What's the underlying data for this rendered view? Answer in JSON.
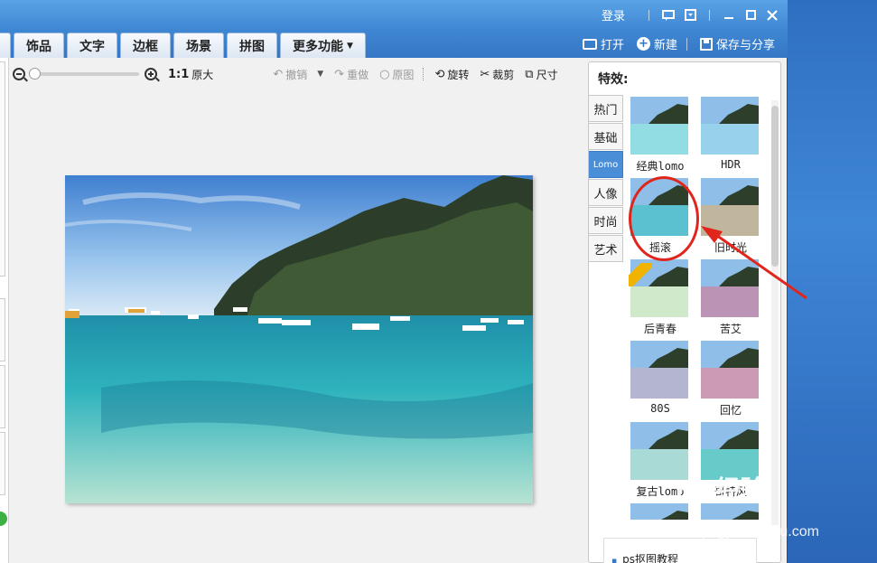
{
  "titlebar": {
    "login": "登录"
  },
  "tabs": [
    {
      "label": "容"
    },
    {
      "label": "饰品"
    },
    {
      "label": "文字"
    },
    {
      "label": "边框"
    },
    {
      "label": "场景"
    },
    {
      "label": "拼图"
    },
    {
      "label": "更多功能"
    }
  ],
  "actions": {
    "open": "打开",
    "new": "新建",
    "save_share": "保存与分享"
  },
  "toolbar": {
    "ratio": "1:1",
    "original_size": "原大",
    "undo": "撤销",
    "redo": "重做",
    "original_image": "原图",
    "rotate": "旋转",
    "crop": "裁剪",
    "size": "尺寸"
  },
  "panel": {
    "title": "特效:",
    "categories": [
      "热门",
      "基础",
      "Lomo",
      "人像",
      "时尚",
      "艺术"
    ],
    "active_category": "Lomo",
    "effects": [
      {
        "label": "经典lomo",
        "tint": "#7fd6e0"
      },
      {
        "label": "HDR",
        "tint": "#86c9e8"
      },
      {
        "label": "摇滚",
        "tint": "#3fb7c9"
      },
      {
        "label": "旧时光",
        "tint": "#b5a98c"
      },
      {
        "label": "后青春",
        "tint": "#c9e6c2"
      },
      {
        "label": "苦艾",
        "tint": "#b080a8"
      },
      {
        "label": "80S",
        "tint": "#a7a9c9"
      },
      {
        "label": "回忆",
        "tint": "#c48aa6"
      },
      {
        "label": "复古lomo",
        "tint": "#9bd4cf"
      },
      {
        "label": "哥特风",
        "tint": "#4cc2c0"
      },
      {
        "label": "",
        "tint": "#7db9d8"
      },
      {
        "label": "",
        "tint": "#b07cc0"
      }
    ],
    "vip_badge": "会员",
    "link": "ps抠图教程"
  },
  "watermark": {
    "brand": "Bai经验",
    "url": "jingyan.baidu.com"
  },
  "colors": {
    "accent": "#3f86d2",
    "annotation": "#e0251c"
  }
}
